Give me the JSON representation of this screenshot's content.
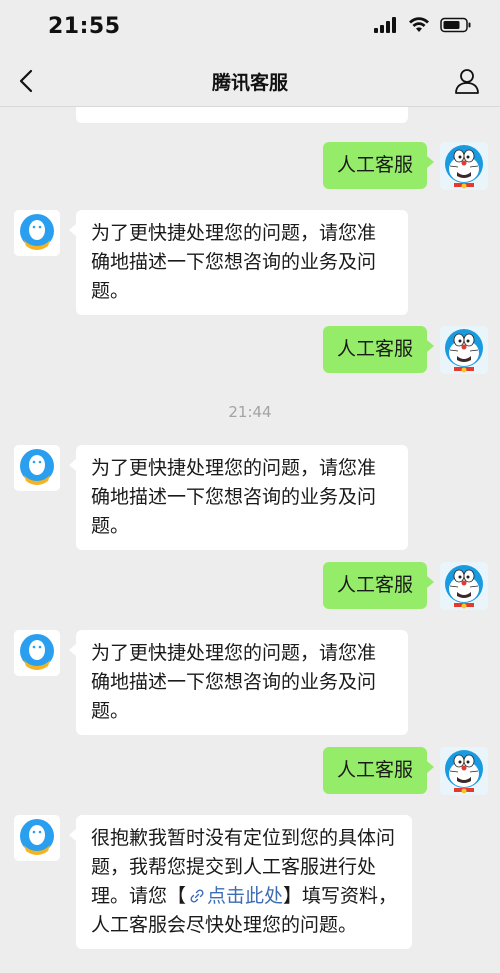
{
  "status_bar": {
    "time": "21:55"
  },
  "nav": {
    "title": "腾讯客服",
    "back_icon": "chevron-left-icon",
    "profile_icon": "person-icon"
  },
  "colors": {
    "background": "#ededed",
    "incoming_bubble": "#ffffff",
    "outgoing_bubble": "#95ec69",
    "link": "#3d6db5"
  },
  "messages": {
    "out_1": "人工客服",
    "in_1": "为了更快捷处理您的问题，请您准确地描述一下您想咨询的业务及问题。",
    "out_2": "人工客服",
    "timestamp": "21:44",
    "in_2": "为了更快捷处理您的问题，请您准确地描述一下您想咨询的业务及问题。",
    "out_3": "人工客服",
    "in_3": "为了更快捷处理您的问题，请您准确地描述一下您想咨询的业务及问题。",
    "out_4": "人工客服",
    "in_4_part1": "很抱歉我暂时没有定位到您的具体问题，我帮您提交到人工客服进行处理。请您【",
    "in_4_link": "点击此处",
    "in_4_part2": "】填写资料，人工客服会尽快处理您的问题。"
  }
}
